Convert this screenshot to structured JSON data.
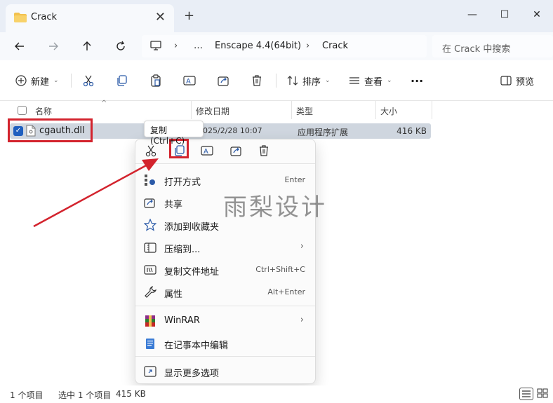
{
  "window": {
    "tab_title": "Crack",
    "new_tab_symbol": "+",
    "tab_close_symbol": "✕",
    "minimize_symbol": "—",
    "maximize_symbol": "☐",
    "close_symbol": "✕"
  },
  "address": {
    "breadcrumb": [
      "…",
      "Enscape 4.4(64bit)",
      "Crack"
    ],
    "separator": "›",
    "search_placeholder": "在 Crack 中搜索"
  },
  "toolbar": {
    "new_label": "新建",
    "sort_label": "排序",
    "view_label": "查看",
    "more_label": "···",
    "preview_label": "预览"
  },
  "columns": [
    "名称",
    "修改日期",
    "类型",
    "大小"
  ],
  "files": [
    {
      "name": "cgauth.dll",
      "date": "2025/2/28 10:07",
      "type": "应用程序扩展",
      "size": "416 KB",
      "selected": true
    }
  ],
  "tooltip": "复制 (Ctrl+C)",
  "context_menu": {
    "icon_actions": [
      "cut-icon",
      "copy-icon",
      "rename-icon",
      "share-icon",
      "delete-icon"
    ],
    "items": [
      {
        "label": "打开方式",
        "shortcut": "Enter",
        "icon": "open-with-icon"
      },
      {
        "label": "共享",
        "shortcut": "",
        "icon": "share-icon"
      },
      {
        "label": "添加到收藏夹",
        "shortcut": "",
        "icon": "star-icon"
      },
      {
        "label": "压缩到...",
        "shortcut": "",
        "icon": "zip-icon",
        "submenu": true
      },
      {
        "label": "复制文件地址",
        "shortcut": "Ctrl+Shift+C",
        "icon": "copy-path-icon"
      },
      {
        "label": "属性",
        "shortcut": "Alt+Enter",
        "icon": "wrench-icon"
      },
      {
        "label": "WinRAR",
        "shortcut": "",
        "icon": "winrar-icon",
        "submenu": true
      },
      {
        "label": "在记事本中编辑",
        "shortcut": "",
        "icon": "notepad-icon"
      },
      {
        "label": "显示更多选项",
        "shortcut": "",
        "icon": "more-options-icon"
      }
    ],
    "submenu_arrow": "›"
  },
  "watermark": "雨梨设计",
  "status": {
    "item_count": "1 个项目",
    "selected": "选中 1 个项目",
    "selected_size": "415 KB"
  },
  "colors": {
    "accent": "#1f5fbf",
    "highlight": "#d3232d",
    "selection_row": "#cfd6df",
    "titlebar": "#e9eef6"
  }
}
